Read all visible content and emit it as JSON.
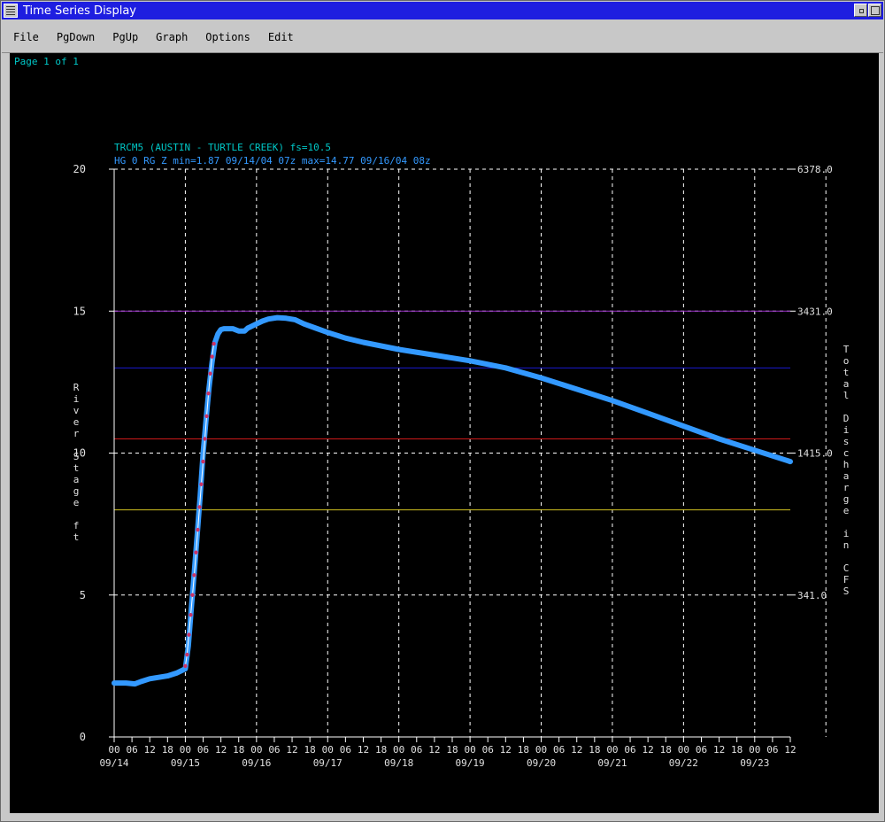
{
  "window": {
    "title": "Time Series Display"
  },
  "menu": [
    "File",
    "PgDown",
    "PgUp",
    "Graph",
    "Options",
    "Edit"
  ],
  "page_indicator": "Page 1 of 1",
  "colors": {
    "text_cyan": "#00c8c8",
    "series": "#3399ff",
    "obs_points": "#cc3366",
    "axis_label": "#e0e0e0",
    "grid": "#ffffff",
    "line_purple": "#9a30c8",
    "line_blue": "#1a1ad0",
    "line_red": "#cc1a1a",
    "line_yellow": "#d0c020"
  },
  "chart_data": {
    "type": "line",
    "title": "TRCM5 (AUSTIN - TURTLE CREEK) fs=10.5",
    "subtitle": "HG 0 RG Z min=1.87 09/14/04 07z max=14.77 09/16/04 08z",
    "ylabel": "River Stage ft",
    "y2label": "Total Discharge in CFS",
    "ylim": [
      0,
      20
    ],
    "yticks": [
      "0",
      "5",
      "10",
      "15",
      "20"
    ],
    "y2ticks": [
      {
        "y": 5,
        "label": "341.0"
      },
      {
        "y": 10,
        "label": "1415.0"
      },
      {
        "y": 15,
        "label": "3431.0"
      },
      {
        "y": 20,
        "label": "6378.0"
      }
    ],
    "x_hour_start": 0,
    "x_hour_end": 228,
    "x_tick_step_hours": 6,
    "hour_labels": [
      "00",
      "06",
      "12",
      "18"
    ],
    "date_labels": [
      "09/14",
      "09/15",
      "09/16",
      "09/17",
      "09/18",
      "09/19",
      "09/20",
      "09/21",
      "09/22",
      "09/23"
    ],
    "threshold_lines": [
      {
        "value": 15.0,
        "color": "#9a30c8"
      },
      {
        "value": 13.0,
        "color": "#1a1ad0"
      },
      {
        "value": 10.5,
        "color": "#cc1a1a"
      },
      {
        "value": 8.0,
        "color": "#d0c020"
      }
    ],
    "series": [
      {
        "kind": "forecast",
        "x_hours": [
          0,
          4,
          7,
          9,
          12,
          15,
          18,
          21,
          24,
          25,
          26,
          27,
          28,
          29,
          30,
          31,
          32,
          33,
          34,
          35,
          36,
          37,
          38,
          40,
          42,
          44,
          45,
          46,
          48,
          50,
          52,
          55,
          58,
          61,
          64,
          68,
          72,
          78,
          84,
          96,
          108,
          120,
          132,
          144,
          156,
          168,
          180,
          192,
          204,
          216,
          228
        ],
        "y": [
          1.9,
          1.9,
          1.87,
          1.95,
          2.05,
          2.1,
          2.15,
          2.25,
          2.4,
          3.2,
          4.5,
          5.8,
          7.1,
          8.5,
          10.0,
          11.2,
          12.3,
          13.2,
          13.9,
          14.2,
          14.35,
          14.38,
          14.38,
          14.38,
          14.3,
          14.3,
          14.4,
          14.45,
          14.55,
          14.65,
          14.72,
          14.77,
          14.75,
          14.7,
          14.55,
          14.4,
          14.25,
          14.05,
          13.9,
          13.65,
          13.45,
          13.25,
          13.0,
          12.65,
          12.25,
          11.85,
          11.4,
          10.95,
          10.5,
          10.1,
          9.7
        ]
      },
      {
        "kind": "observed",
        "x_hours": [
          24,
          24.6,
          25.2,
          25.8,
          26.4,
          27,
          27.6,
          28.2,
          28.8,
          29.4,
          30,
          30.6,
          31.2,
          31.8,
          32.4,
          33,
          33.6
        ],
        "y": [
          2.5,
          2.9,
          3.6,
          4.3,
          5.0,
          5.7,
          6.5,
          7.3,
          8.1,
          8.9,
          9.7,
          10.5,
          11.3,
          12.1,
          12.8,
          13.4,
          13.85
        ]
      }
    ]
  }
}
